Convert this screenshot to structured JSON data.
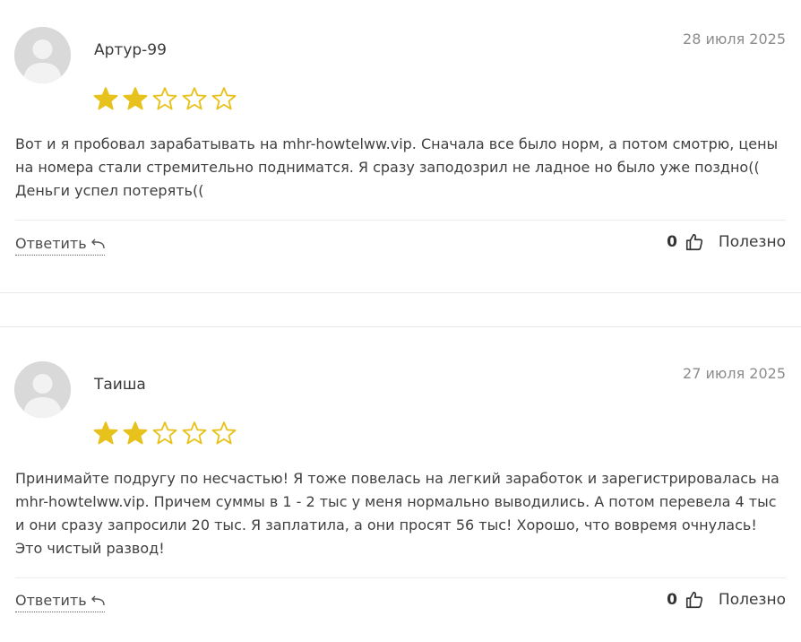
{
  "reviews": [
    {
      "author": "Артур-99",
      "date": "28 июля 2025",
      "rating": 2,
      "max_rating": 5,
      "text": "Вот и я пробовал зарабатывать на mhr-howtelww.vip. Сначала все было норм, а потом смотрю, цены на номера стали стремительно подниматся. Я сразу заподозрил не ладное но было уже поздно(( Деньги успел потерять((",
      "reply_label": "Ответить",
      "likes": "0",
      "helpful_label": "Полезно"
    },
    {
      "author": "Таиша",
      "date": "27 июля 2025",
      "rating": 2,
      "max_rating": 5,
      "text": "Принимайте подругу по несчастью! Я тоже повелась на легкий заработок и зарегистрировалась на mhr-howtelww.vip. Причем суммы в 1 - 2 тыс у меня нормально выводились. А потом перевела 4 тыс и они сразу запросили 20 тыс. Я заплатила, а они просят 56 тыс! Хорошо, что вовремя очнулась! Это чистый развод!",
      "reply_label": "Ответить",
      "likes": "0",
      "helpful_label": "Полезно"
    }
  ],
  "colors": {
    "star_filled": "#e8c21c",
    "star_outline": "#e8c21c",
    "avatar_bg": "#d9d9d9",
    "avatar_fg": "#f2f2f2",
    "date_text": "#8c8c8c"
  },
  "icons": {
    "avatar": "default-user-avatar",
    "star": "star-icon",
    "reply": "reply-arrow-icon",
    "like": "thumbs-up-icon"
  }
}
